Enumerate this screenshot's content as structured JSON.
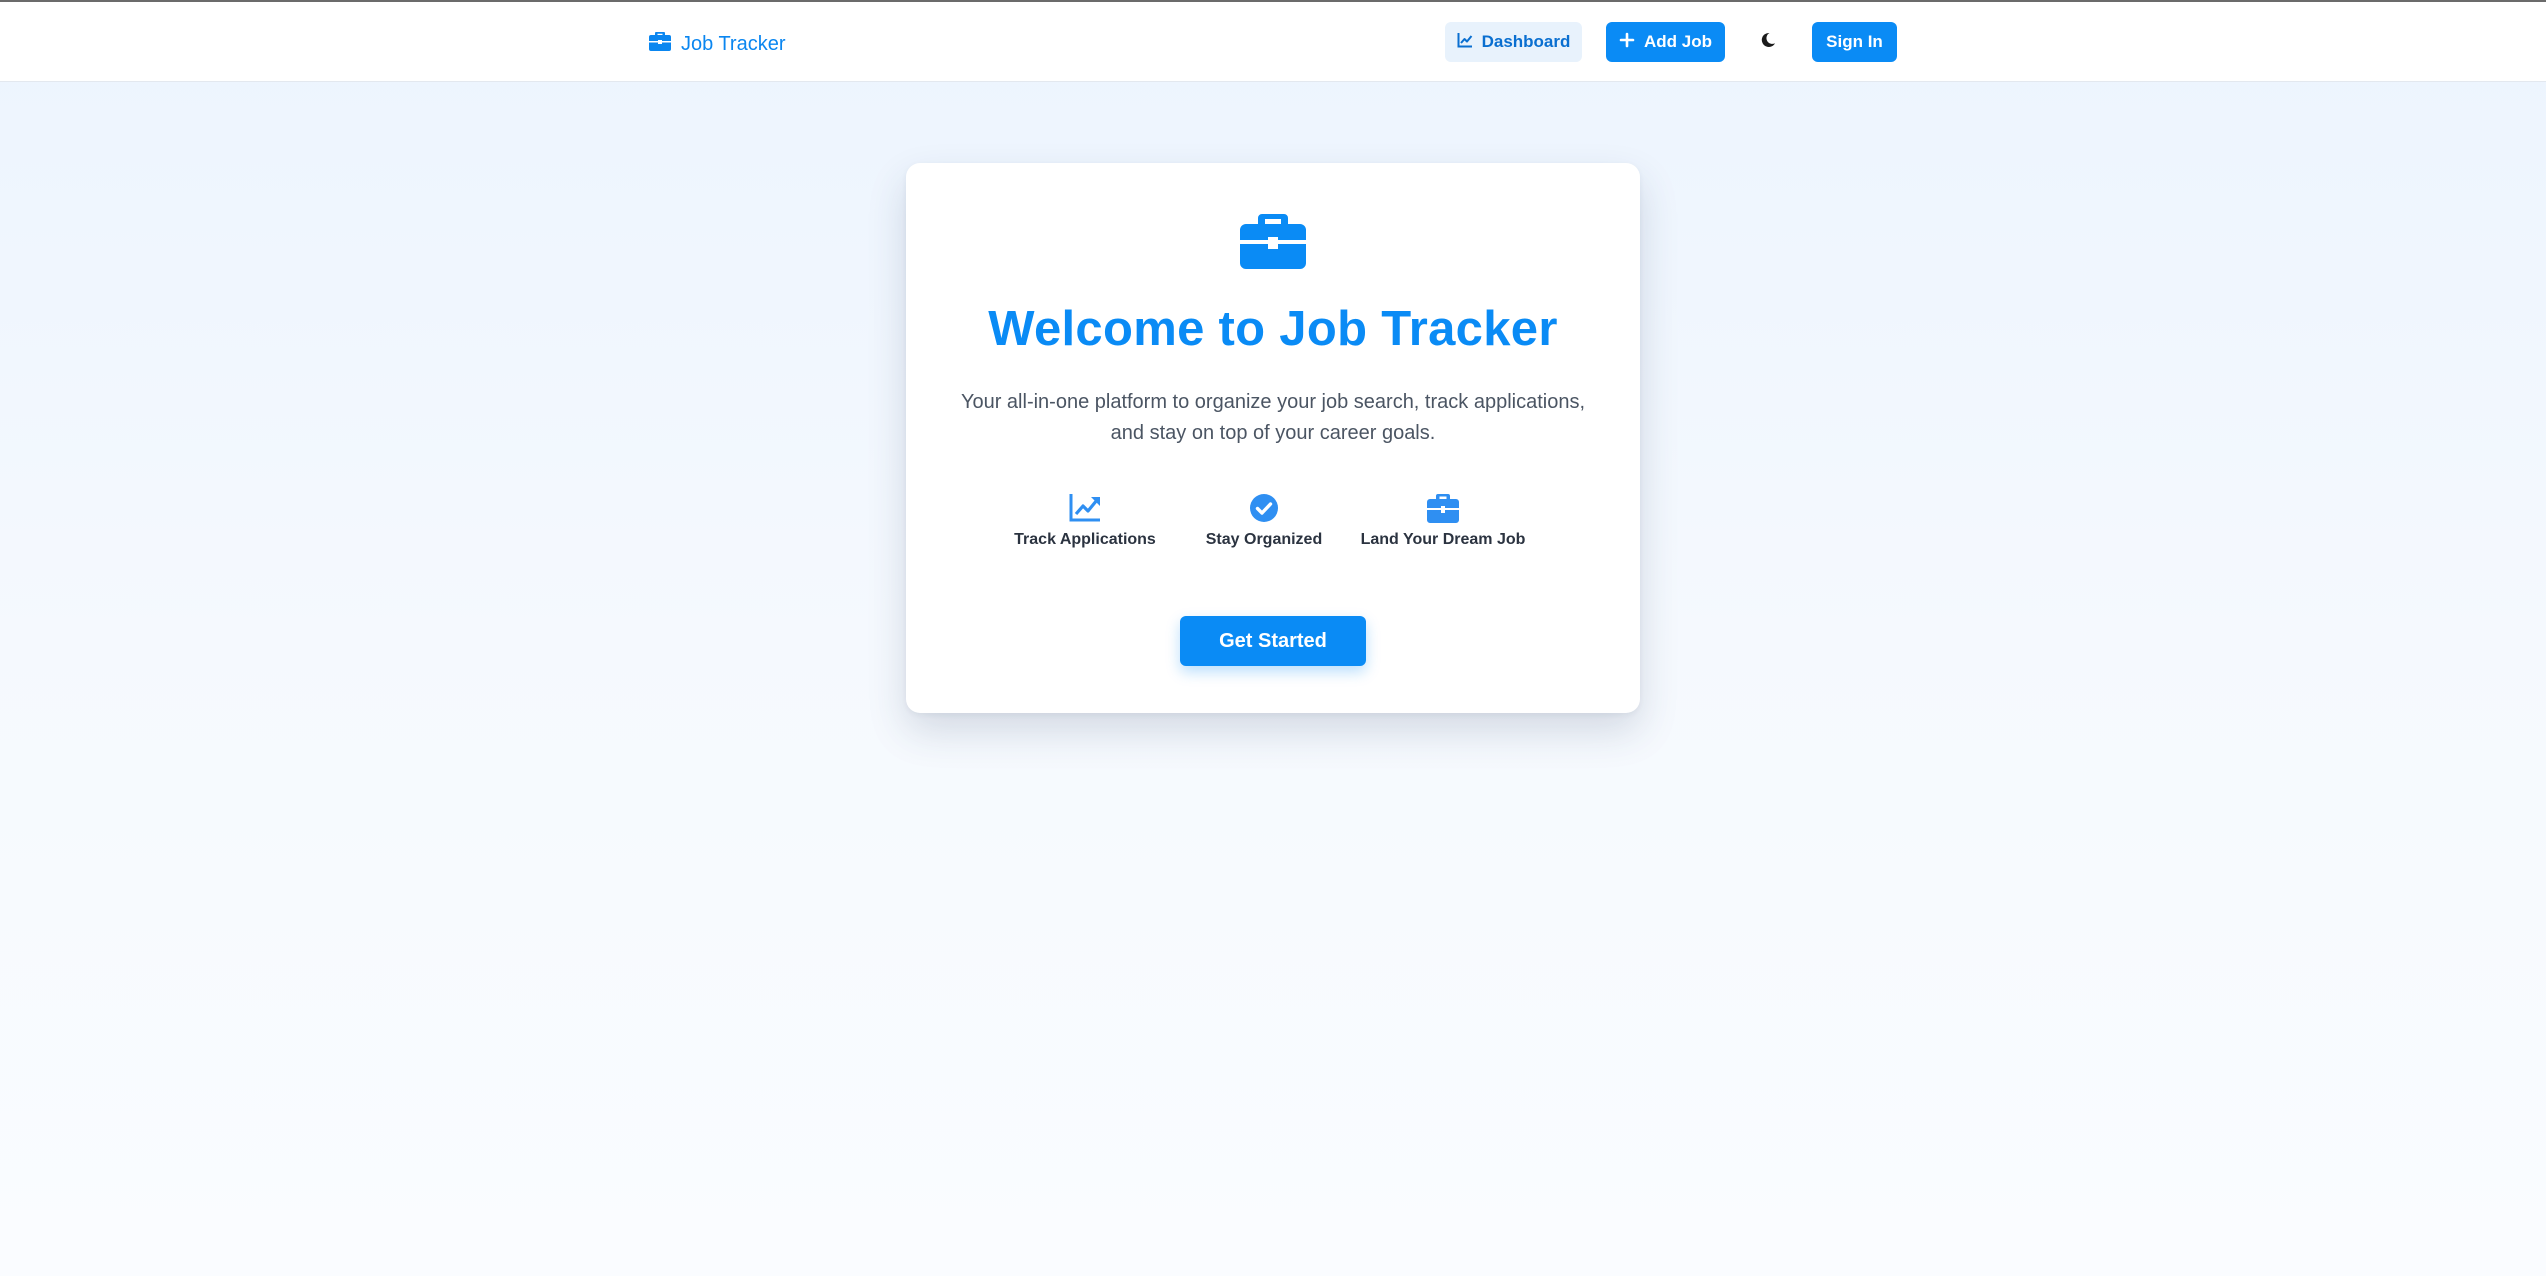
{
  "nav": {
    "brand": "Job Tracker",
    "brand_icon": "briefcase-icon",
    "dashboard_label": "Dashboard",
    "dashboard_icon": "chart-line-icon",
    "add_job_label": "Add Job",
    "add_job_icon": "plus-icon",
    "theme_icon": "moon-icon",
    "sign_in_label": "Sign In"
  },
  "hero": {
    "icon": "briefcase-icon",
    "title": "Welcome to Job Tracker",
    "subtitle_line1": "Your all-in-one platform to organize your job search, track applications,",
    "subtitle_line2": "and stay on top of your career goals.",
    "features": [
      {
        "label": "Track Applications",
        "icon": "chart-line-icon"
      },
      {
        "label": "Stay Organized",
        "icon": "check-circle-icon"
      },
      {
        "label": "Land Your Dream Job",
        "icon": "briefcase-icon"
      }
    ],
    "cta_label": "Get Started"
  },
  "colors": {
    "accent": "#0a8bf5",
    "text_muted": "#4b5563",
    "background": "#ecf4fe"
  }
}
